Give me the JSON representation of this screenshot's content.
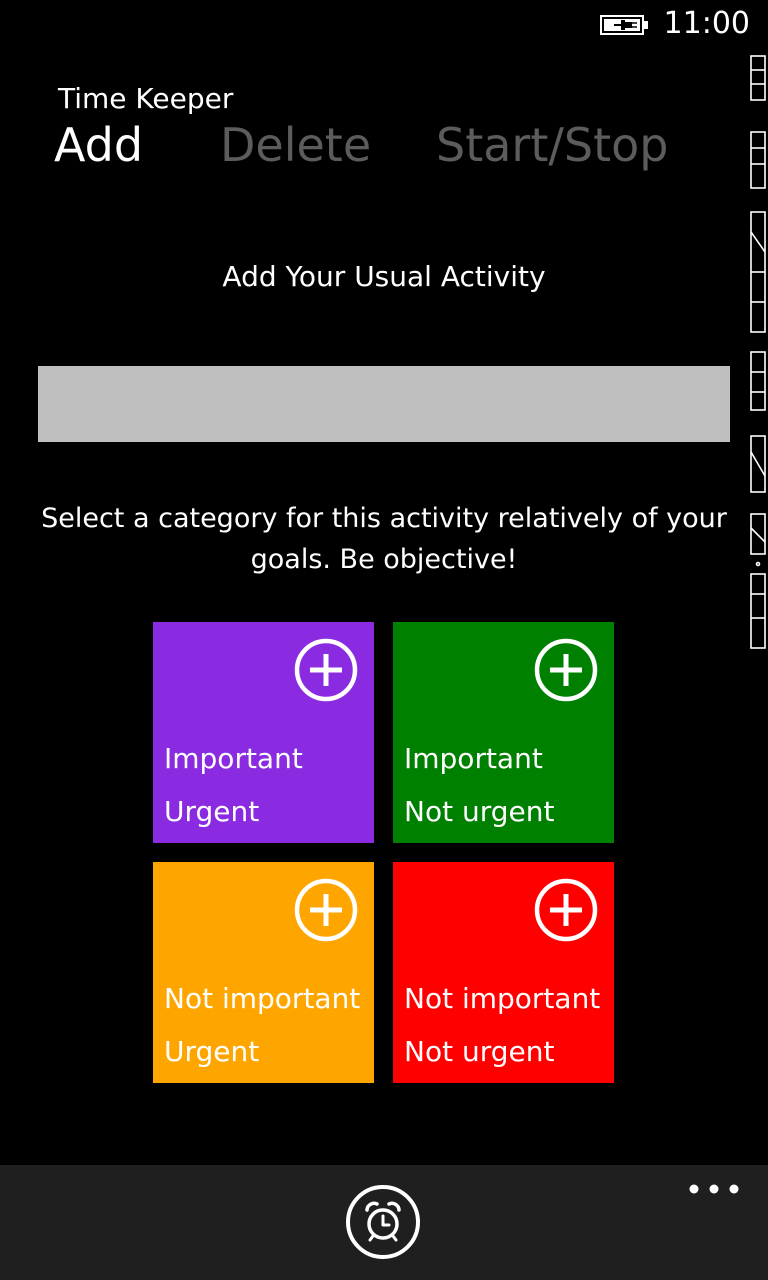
{
  "status": {
    "time": "11:00",
    "battery_icon": "battery-charging-icon"
  },
  "app": {
    "title": "Time Keeper"
  },
  "pivot": {
    "tabs": [
      {
        "label": "Add",
        "active": true
      },
      {
        "label": "Delete",
        "active": false
      },
      {
        "label": "Start/Stop",
        "active": false
      }
    ]
  },
  "form": {
    "heading": "Add Your Usual Activity",
    "activity_value": "",
    "instructions": "Select a category for this activity relatively of your goals. Be objective!"
  },
  "categories": [
    {
      "line1": "Important",
      "line2": "Urgent",
      "color": "#8a2be2",
      "icon": "plus-circle-icon"
    },
    {
      "line1": "Important",
      "line2": "Not urgent",
      "color": "#008000",
      "icon": "plus-circle-icon"
    },
    {
      "line1": "Not important",
      "line2": "Urgent",
      "color": "#ffa500",
      "icon": "plus-circle-icon"
    },
    {
      "line1": "Not important",
      "line2": "Not urgent",
      "color": "#ff0000",
      "icon": "plus-circle-icon"
    }
  ],
  "app_bar": {
    "alarm_icon": "alarm-clock-icon",
    "more_icon": "ellipsis-icon"
  }
}
